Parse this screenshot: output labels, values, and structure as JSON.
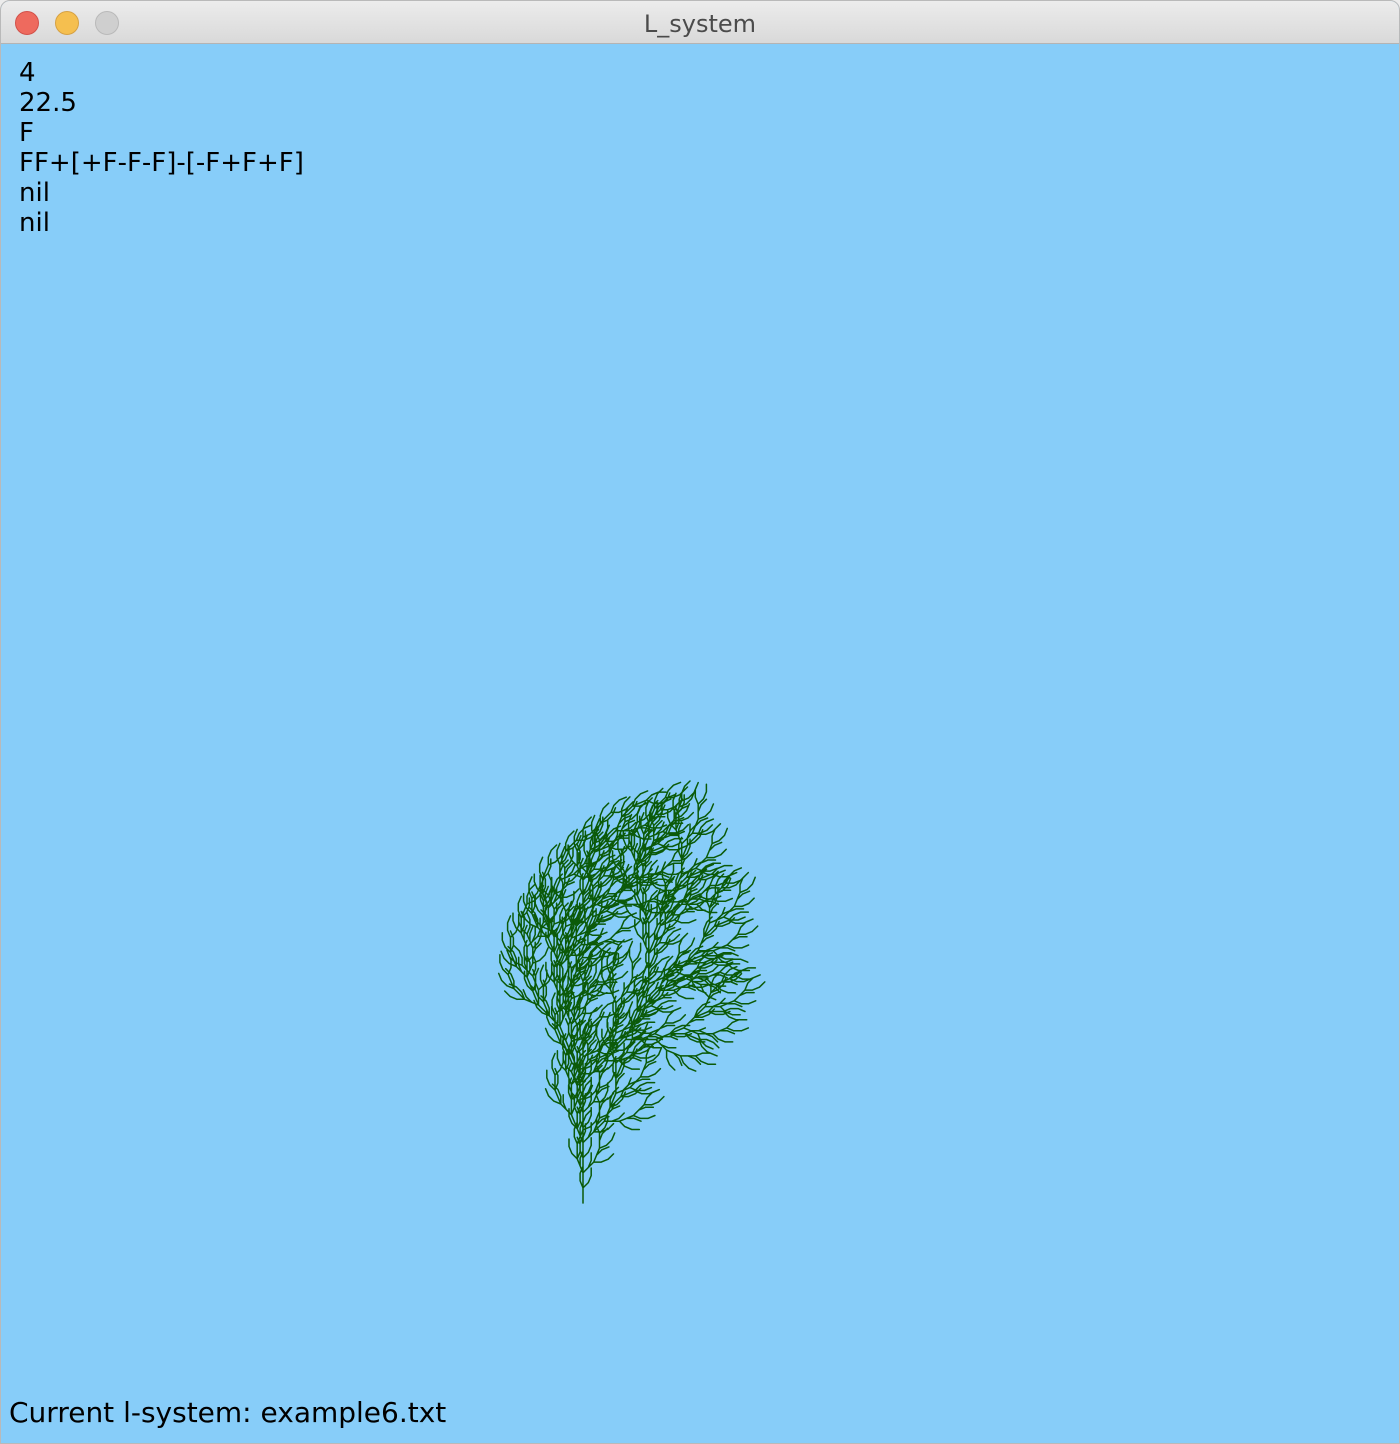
{
  "window": {
    "title": "L_system"
  },
  "lsystem": {
    "params": [
      "4",
      "22.5",
      "F",
      "FF+[+F-F-F]-[-F+F+F]",
      "nil",
      "nil"
    ],
    "iterations": 4,
    "angle_deg": 22.5,
    "axiom": "F",
    "rules": {
      "F": "FF+[+F-F-F]-[-F+F+F]"
    },
    "line_color": "#0b5a09",
    "background_color": "#87cdf9"
  },
  "status": {
    "text": "Current l-system: example6.txt"
  }
}
